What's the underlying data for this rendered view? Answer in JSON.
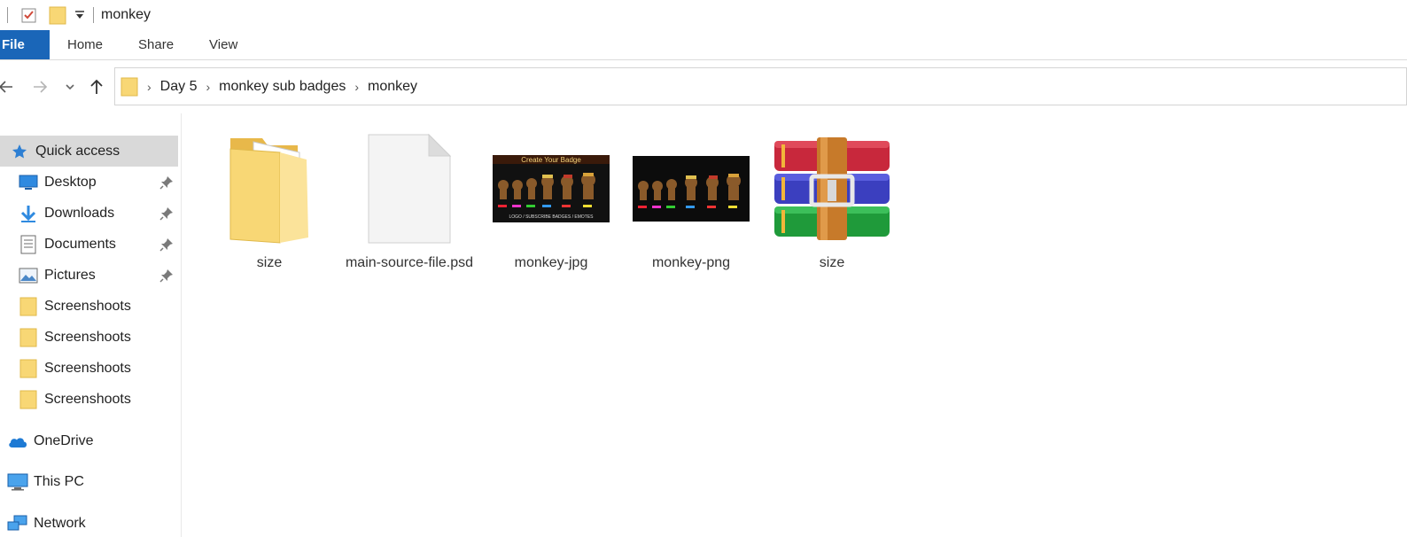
{
  "window": {
    "title": "monkey"
  },
  "ribbon": {
    "tabs": [
      "File",
      "Home",
      "Share",
      "View"
    ]
  },
  "breadcrumb": [
    "Day 5",
    "monkey sub badges",
    "monkey"
  ],
  "sidebar": {
    "quick_access": "Quick access",
    "items": [
      {
        "label": "Desktop",
        "icon": "desktop-icon",
        "pinned": true
      },
      {
        "label": "Downloads",
        "icon": "downloads-icon",
        "pinned": true
      },
      {
        "label": "Documents",
        "icon": "documents-icon",
        "pinned": true
      },
      {
        "label": "Pictures",
        "icon": "pictures-icon",
        "pinned": true
      },
      {
        "label": "Screenshoots",
        "icon": "folder-icon",
        "pinned": false
      },
      {
        "label": "Screenshoots",
        "icon": "folder-icon",
        "pinned": false
      },
      {
        "label": "Screenshoots",
        "icon": "folder-icon",
        "pinned": false
      },
      {
        "label": "Screenshoots",
        "icon": "folder-icon",
        "pinned": false
      }
    ],
    "onedrive": "OneDrive",
    "this_pc": "This PC",
    "network": "Network"
  },
  "files": [
    {
      "name": "size",
      "type": "folder"
    },
    {
      "name": "main-source-file.psd",
      "type": "psd"
    },
    {
      "name": "monkey-jpg",
      "type": "image"
    },
    {
      "name": "monkey-png",
      "type": "image"
    },
    {
      "name": "size",
      "type": "archive"
    }
  ],
  "thumbnail_text": {
    "headline": "Create Your Badge",
    "footer": "LOGO / SUBSCRIBE BADGES / EMOTES"
  },
  "colors": {
    "file_tab": "#1a66b8",
    "folder": "#f8d775",
    "selected": "#d9d9d9"
  }
}
